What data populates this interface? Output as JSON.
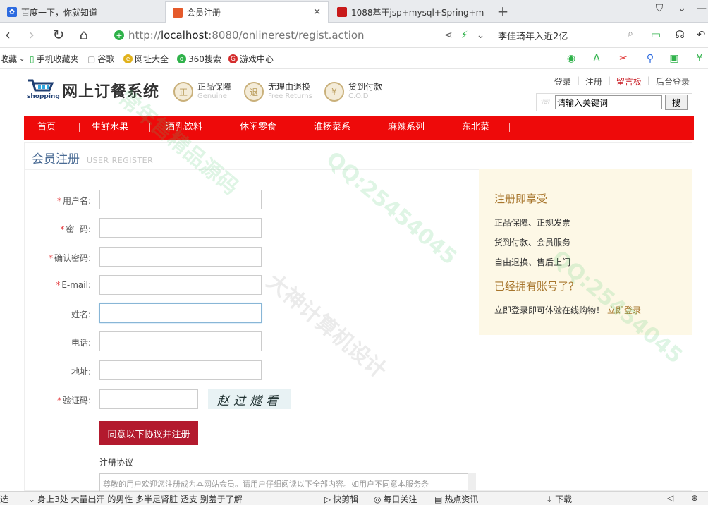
{
  "browser": {
    "tabs": [
      {
        "title": "百度一下，你就知道",
        "icon": "baidu-paw-icon",
        "active": false
      },
      {
        "title": "会员注册",
        "icon": "page-icon",
        "active": true
      },
      {
        "title": "1088基于jsp+mysql+Spring+m",
        "icon": "red-page-icon",
        "active": false
      }
    ],
    "url": {
      "scheme": "http://",
      "host": "localhost",
      "path": ":8080/onlinerest/regist.action"
    },
    "hot_search": "李佳琦年入近2亿",
    "favorites": [
      {
        "label": "收藏",
        "icon": "chevron-down-icon"
      },
      {
        "label": "手机收藏夹",
        "icon": "phone-icon"
      },
      {
        "label": "谷歌",
        "icon": "page-icon"
      },
      {
        "label": "网址大全",
        "icon": "globe-icon"
      },
      {
        "label": "360搜索",
        "icon": "search-icon"
      },
      {
        "label": "游戏中心",
        "icon": "game-icon"
      }
    ]
  },
  "site": {
    "name": "网上订餐系统",
    "logo_sub": "shopping",
    "badges": [
      {
        "title": "正品保障",
        "sub": "Genuine",
        "seal": "正"
      },
      {
        "title": "无理由退换",
        "sub": "Free Returns",
        "seal": "退"
      },
      {
        "title": "货到付款",
        "sub": "C.O.D",
        "seal": "¥"
      }
    ],
    "top_links": [
      "登录",
      "注册",
      "留言板",
      "后台登录"
    ],
    "search": {
      "value": "请输入关键词",
      "button": "搜"
    },
    "nav": [
      "首页",
      "生鲜水果",
      "酒乳饮料",
      "休闲零食",
      "淮扬菜系",
      "麻辣系列",
      "东北菜"
    ]
  },
  "register": {
    "title": "会员注册",
    "title_en": "USER REGISTER",
    "fields": [
      {
        "label": "用户名:",
        "required": true
      },
      {
        "label": "密  码:",
        "required": true
      },
      {
        "label": "确认密码:",
        "required": true
      },
      {
        "label": "E-mail:",
        "required": true
      },
      {
        "label": "姓名:",
        "required": false
      },
      {
        "label": "电话:",
        "required": false
      },
      {
        "label": "地址:",
        "required": false
      },
      {
        "label": "验证码:",
        "required": true
      }
    ],
    "captcha_text": "赵过燧看",
    "submit": "同意以下协议并注册",
    "agreement_label": "注册协议",
    "agreement_text": "尊敬的用户欢迎您注册成为本网站会员。请用户仔细阅读以下全部内容。如用户不同意本服务条"
  },
  "benefit": {
    "heading": "注册即享受",
    "items": [
      "正品保障、正规发票",
      "货到付款、会员服务",
      "自由退换、售后上门"
    ],
    "heading2": "已经拥有账号了？",
    "login_text": "立即登录即可体验在线购物！",
    "login_link": "立即登录"
  },
  "statusbar": {
    "items": [
      "选",
      "身上3处 大量出汗 的男性 多半是肾脏 透支 别羞于了解",
      "快剪辑",
      "每日关注",
      "热点资讯",
      "下载"
    ]
  },
  "watermarks": [
    "QQ:25454045",
    "大神计算机设计",
    "常年售精品源码"
  ],
  "colors": {
    "nav_red": "#ee0a0a",
    "submit_red": "#b31a2e",
    "title_blue": "#4a6b94",
    "benefit_bg": "#fdf8e6",
    "benefit_gold": "#a8762d"
  }
}
